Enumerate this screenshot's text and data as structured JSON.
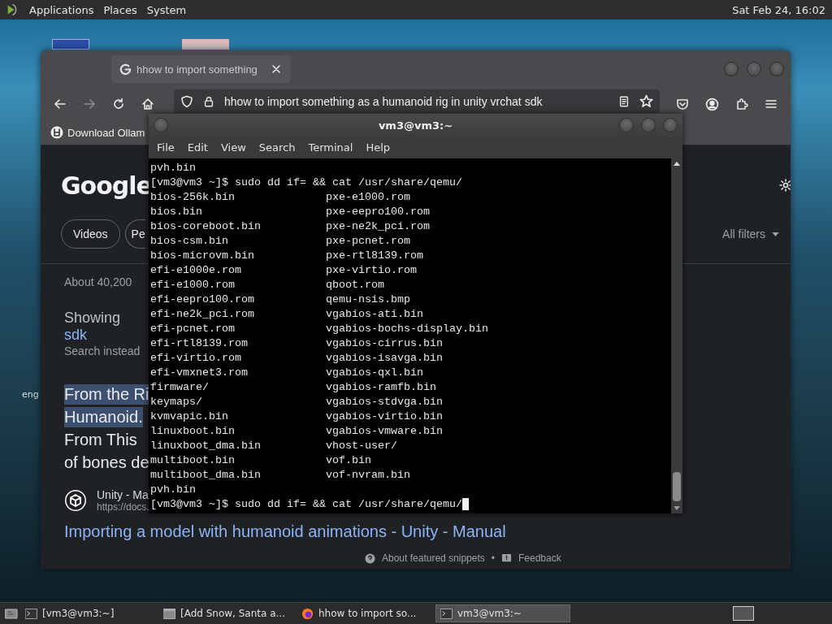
{
  "top_panel": {
    "menus": [
      "Applications",
      "Places",
      "System"
    ],
    "clock": "Sat Feb 24, 16:02"
  },
  "desktop": {
    "icon_label": "eng"
  },
  "browser": {
    "tabs": [
      {
        "title": "hhow to import something",
        "selected": true
      }
    ],
    "url": "hhow to import something as a humanoid rig in unity vrchat sdk",
    "bookmarks": [
      "Download Ollam"
    ],
    "page": {
      "logo": "Google",
      "chips": [
        "Videos",
        "Pe"
      ],
      "all_filters": "All filters",
      "result_count": "About 40,200",
      "showing": "Showing",
      "corrected_link": "sdk",
      "search_instead": "Search instead",
      "snippet_lines": [
        {
          "text": "From the Ri",
          "highlighted": true
        },
        {
          "text": "Humanoid.",
          "highlighted": true
        },
        {
          "text": "From This",
          "highlighted": false
        },
        {
          "text": "of bones de",
          "highlighted": false
        }
      ],
      "source_name": "Unity - Ma",
      "source_url": "https://docs.",
      "result_title": "Importing a model with humanoid animations - Unity - Manual",
      "footer": [
        "About featured snippets",
        "Feedback"
      ],
      "footer_separator": "•"
    }
  },
  "terminal": {
    "title": "vm3@vm3:~",
    "menus": [
      "File",
      "Edit",
      "View",
      "Search",
      "Terminal",
      "Help"
    ],
    "lines": [
      {
        "kind": "output",
        "cols": [
          "pvh.bin"
        ]
      },
      {
        "kind": "prompt",
        "text": "[vm3@vm3 ~]$ sudo dd if= && cat /usr/share/qemu/",
        "cursor": false
      },
      {
        "kind": "output",
        "cols": [
          "bios-256k.bin",
          "pxe-e1000.rom"
        ]
      },
      {
        "kind": "output",
        "cols": [
          "bios.bin",
          "pxe-eepro100.rom"
        ]
      },
      {
        "kind": "output",
        "cols": [
          "bios-coreboot.bin",
          "pxe-ne2k_pci.rom"
        ]
      },
      {
        "kind": "output",
        "cols": [
          "bios-csm.bin",
          "pxe-pcnet.rom"
        ]
      },
      {
        "kind": "output",
        "cols": [
          "bios-microvm.bin",
          "pxe-rtl8139.rom"
        ]
      },
      {
        "kind": "output",
        "cols": [
          "efi-e1000e.rom",
          "pxe-virtio.rom"
        ]
      },
      {
        "kind": "output",
        "cols": [
          "efi-e1000.rom",
          "qboot.rom"
        ]
      },
      {
        "kind": "output",
        "cols": [
          "efi-eepro100.rom",
          "qemu-nsis.bmp"
        ]
      },
      {
        "kind": "output",
        "cols": [
          "efi-ne2k_pci.rom",
          "vgabios-ati.bin"
        ]
      },
      {
        "kind": "output",
        "cols": [
          "efi-pcnet.rom",
          "vgabios-bochs-display.bin"
        ]
      },
      {
        "kind": "output",
        "cols": [
          "efi-rtl8139.rom",
          "vgabios-cirrus.bin"
        ]
      },
      {
        "kind": "output",
        "cols": [
          "efi-virtio.rom",
          "vgabios-isavga.bin"
        ]
      },
      {
        "kind": "output",
        "cols": [
          "efi-vmxnet3.rom",
          "vgabios-qxl.bin"
        ]
      },
      {
        "kind": "output",
        "cols": [
          "firmware/",
          "vgabios-ramfb.bin"
        ]
      },
      {
        "kind": "output",
        "cols": [
          "keymaps/",
          "vgabios-stdvga.bin"
        ]
      },
      {
        "kind": "output",
        "cols": [
          "kvmvapic.bin",
          "vgabios-virtio.bin"
        ]
      },
      {
        "kind": "output",
        "cols": [
          "linuxboot.bin",
          "vgabios-vmware.bin"
        ]
      },
      {
        "kind": "output",
        "cols": [
          "linuxboot_dma.bin",
          "vhost-user/"
        ]
      },
      {
        "kind": "output",
        "cols": [
          "multiboot.bin",
          "vof.bin"
        ]
      },
      {
        "kind": "output",
        "cols": [
          "multiboot_dma.bin",
          "vof-nvram.bin"
        ]
      },
      {
        "kind": "output",
        "cols": [
          "pvh.bin"
        ]
      },
      {
        "kind": "prompt",
        "text": "[vm3@vm3 ~]$ sudo dd if= && cat /usr/share/qemu/",
        "cursor": true
      }
    ]
  },
  "taskbar": {
    "items": [
      {
        "label": "[vm3@vm3:~]",
        "kind": "terminal",
        "selected": false
      },
      {
        "label": "[Add Snow, Santa a...",
        "kind": "window",
        "selected": false
      },
      {
        "label": "hhow to import so...",
        "kind": "browser",
        "selected": false
      },
      {
        "label": "vm3@vm3:~",
        "kind": "terminal",
        "selected": true
      }
    ]
  }
}
